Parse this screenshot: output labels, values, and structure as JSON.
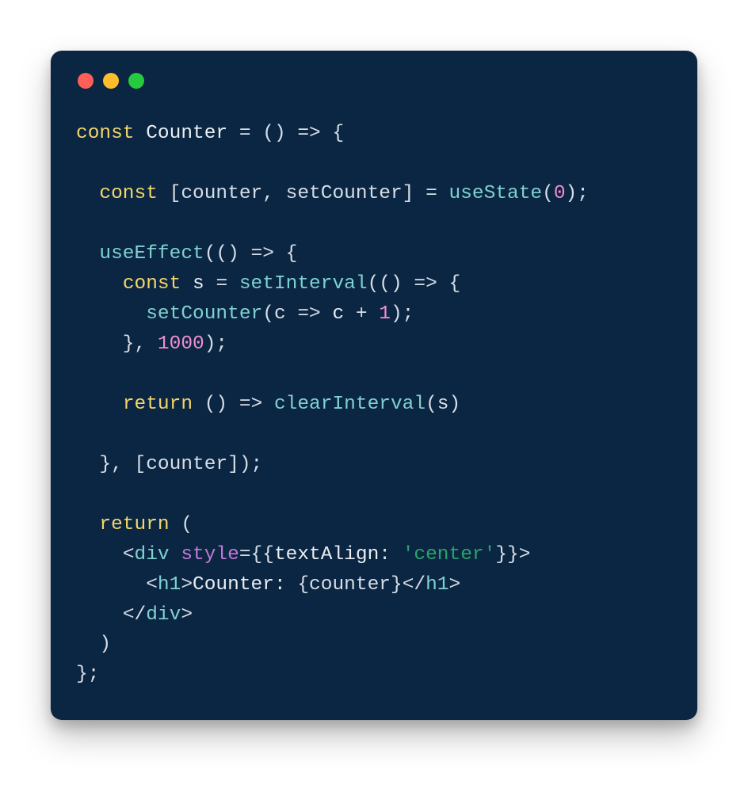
{
  "window": {
    "dots": [
      "red",
      "yellow",
      "green"
    ]
  },
  "colors": {
    "bg": "#0b2642",
    "keyword": "#f3d66b",
    "function": "#7fd1d1",
    "identifier": "#e9eef3",
    "punct": "#d7dee7",
    "number": "#f08fd0",
    "attr": "#c178d6",
    "string": "#2aa36a"
  },
  "code": {
    "plain": "const Counter = () => {\n\n  const [counter, setCounter] = useState(0);\n\n  useEffect(() => {\n    const s = setInterval(() => {\n      setCounter(c => c + 1);\n    }, 1000);\n\n    return () => clearInterval(s)\n\n  }, [counter]);\n\n  return (\n    <div style={{textAlign: 'center'}}>\n      <h1>Counter: {counter}</h1>\n    </div>\n  )\n};",
    "tokens": [
      [
        {
          "t": "const ",
          "c": "kw"
        },
        {
          "t": "Counter ",
          "c": "id"
        },
        {
          "t": "= ",
          "c": "op"
        },
        {
          "t": "() ",
          "c": "pn"
        },
        {
          "t": "=> ",
          "c": "op"
        },
        {
          "t": "{",
          "c": "pn"
        }
      ],
      [
        {
          "t": "",
          "c": "pn"
        }
      ],
      [
        {
          "t": "  ",
          "c": "pn"
        },
        {
          "t": "const ",
          "c": "kw"
        },
        {
          "t": "[counter, setCounter] ",
          "c": "pn"
        },
        {
          "t": "= ",
          "c": "op"
        },
        {
          "t": "useState",
          "c": "fn"
        },
        {
          "t": "(",
          "c": "pn"
        },
        {
          "t": "0",
          "c": "num"
        },
        {
          "t": ");",
          "c": "pn"
        }
      ],
      [
        {
          "t": "",
          "c": "pn"
        }
      ],
      [
        {
          "t": "  ",
          "c": "pn"
        },
        {
          "t": "useEffect",
          "c": "fn"
        },
        {
          "t": "(() ",
          "c": "pn"
        },
        {
          "t": "=> ",
          "c": "op"
        },
        {
          "t": "{",
          "c": "pn"
        }
      ],
      [
        {
          "t": "    ",
          "c": "pn"
        },
        {
          "t": "const ",
          "c": "kw"
        },
        {
          "t": "s ",
          "c": "id"
        },
        {
          "t": "= ",
          "c": "op"
        },
        {
          "t": "setInterval",
          "c": "fn"
        },
        {
          "t": "(() ",
          "c": "pn"
        },
        {
          "t": "=> ",
          "c": "op"
        },
        {
          "t": "{",
          "c": "pn"
        }
      ],
      [
        {
          "t": "      ",
          "c": "pn"
        },
        {
          "t": "setCounter",
          "c": "fn"
        },
        {
          "t": "(c ",
          "c": "pn"
        },
        {
          "t": "=> ",
          "c": "op"
        },
        {
          "t": "c ",
          "c": "id"
        },
        {
          "t": "+ ",
          "c": "op"
        },
        {
          "t": "1",
          "c": "num"
        },
        {
          "t": ");",
          "c": "pn"
        }
      ],
      [
        {
          "t": "    }, ",
          "c": "pn"
        },
        {
          "t": "1000",
          "c": "num"
        },
        {
          "t": ");",
          "c": "pn"
        }
      ],
      [
        {
          "t": "",
          "c": "pn"
        }
      ],
      [
        {
          "t": "    ",
          "c": "pn"
        },
        {
          "t": "return ",
          "c": "kw"
        },
        {
          "t": "() ",
          "c": "pn"
        },
        {
          "t": "=> ",
          "c": "op"
        },
        {
          "t": "clearInterval",
          "c": "fn"
        },
        {
          "t": "(s)",
          "c": "pn"
        }
      ],
      [
        {
          "t": "",
          "c": "pn"
        }
      ],
      [
        {
          "t": "  }, [counter]);",
          "c": "pn"
        }
      ],
      [
        {
          "t": "",
          "c": "pn"
        }
      ],
      [
        {
          "t": "  ",
          "c": "pn"
        },
        {
          "t": "return ",
          "c": "kw"
        },
        {
          "t": "(",
          "c": "pn"
        }
      ],
      [
        {
          "t": "    ",
          "c": "pn"
        },
        {
          "t": "<",
          "c": "pn"
        },
        {
          "t": "div ",
          "c": "tag"
        },
        {
          "t": "style",
          "c": "attr"
        },
        {
          "t": "={{",
          "c": "pn"
        },
        {
          "t": "textAlign",
          "c": "id"
        },
        {
          "t": ": ",
          "c": "pn"
        },
        {
          "t": "'center'",
          "c": "str"
        },
        {
          "t": "}}>",
          "c": "pn"
        }
      ],
      [
        {
          "t": "      ",
          "c": "pn"
        },
        {
          "t": "<",
          "c": "pn"
        },
        {
          "t": "h1",
          "c": "tag"
        },
        {
          "t": ">",
          "c": "pn"
        },
        {
          "t": "Counter: ",
          "c": "txt"
        },
        {
          "t": "{counter}",
          "c": "pn"
        },
        {
          "t": "</",
          "c": "pn"
        },
        {
          "t": "h1",
          "c": "tag"
        },
        {
          "t": ">",
          "c": "pn"
        }
      ],
      [
        {
          "t": "    ",
          "c": "pn"
        },
        {
          "t": "</",
          "c": "pn"
        },
        {
          "t": "div",
          "c": "tag"
        },
        {
          "t": ">",
          "c": "pn"
        }
      ],
      [
        {
          "t": "  )",
          "c": "pn"
        }
      ],
      [
        {
          "t": "};",
          "c": "pn"
        }
      ]
    ]
  }
}
